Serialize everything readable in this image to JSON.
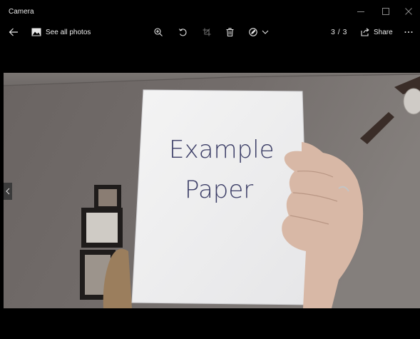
{
  "window": {
    "title": "Camera"
  },
  "toolbar": {
    "see_all_label": "See all photos",
    "counter": "3 / 3",
    "share_label": "Share"
  },
  "photo": {
    "paper_line1": "Example",
    "paper_line2": "Paper"
  },
  "icons": {
    "back": "back-arrow-icon",
    "gallery": "image-icon",
    "zoom": "zoom-in-icon",
    "rotate": "rotate-icon",
    "crop": "crop-icon",
    "delete": "trash-icon",
    "edit": "edit-create-icon",
    "chevron": "chevron-down-icon",
    "share": "share-icon",
    "more": "more-icon",
    "prev": "chevron-left-icon"
  },
  "colors": {
    "background": "#000000",
    "toolbar_text": "#e6e6e6",
    "ink": "#3b3d66"
  }
}
